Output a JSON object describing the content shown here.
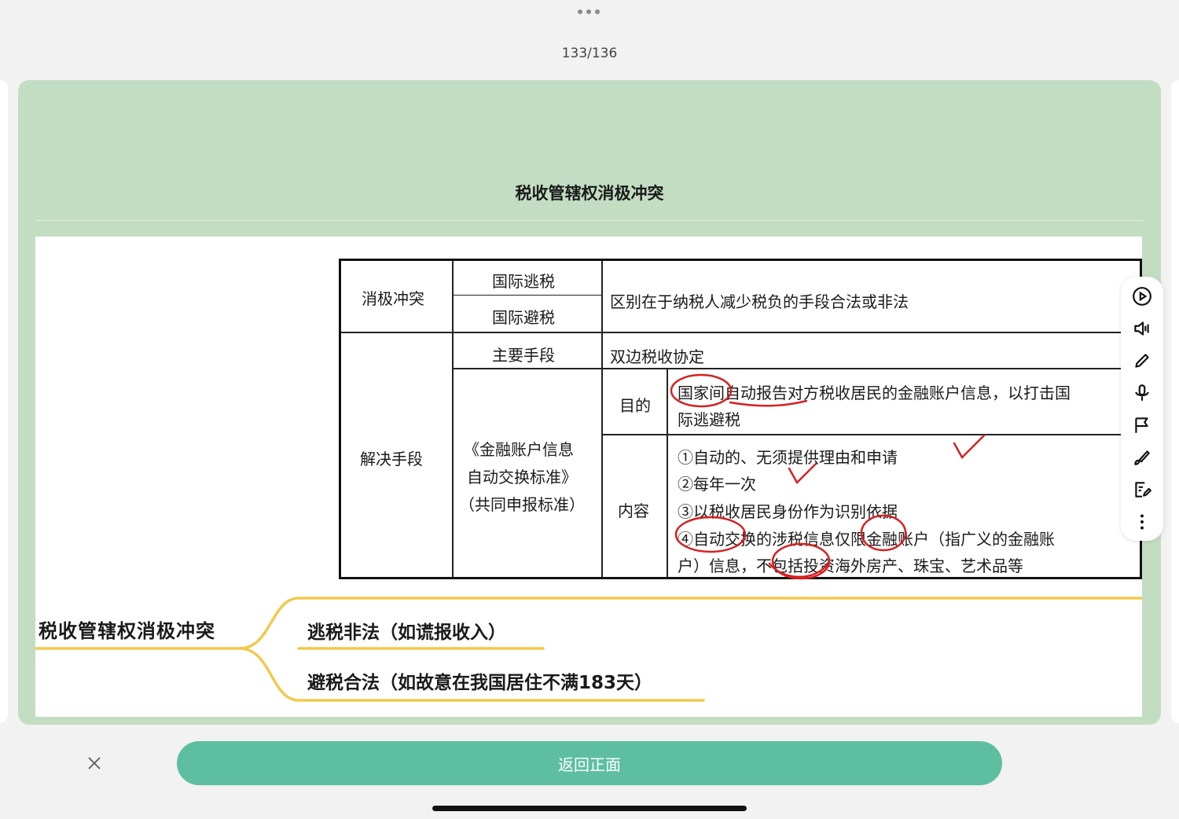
{
  "header": {
    "page_counter": "133/136"
  },
  "card": {
    "title": "税收管辖权消极冲突",
    "table": {
      "r1c1": "消极冲突",
      "r1c2a": "国际逃税",
      "r1c2b": "国际避税",
      "r1c3": "区别在于纳税人减少税负的手段合法或非法",
      "r2c1": "解决手段",
      "r2c2": "主要手段",
      "r2c3": "双边税收协定",
      "r3c2_line1": "《金融账户信息",
      "r3c2_line2": "自动交换标准》",
      "r3c2_line3": "（共同申报标准）",
      "purpose_label": "目的",
      "purpose_line1": "国家间自动报告对方税收居民的金融账户信息，以打击国",
      "purpose_line2": "际逃避税",
      "content_label": "内容",
      "content_1": "①自动的、无须提供理由和申请",
      "content_2": "②每年一次",
      "content_3": "③以税收居民身份作为识别依据",
      "content_4a": "④自动交换的涉税信息仅限金融账户（指广义的金融账",
      "content_4b": "户）信息，不包括投资海外房产、珠宝、艺术品等"
    },
    "mindmap": {
      "root": "税收管辖权消极冲突",
      "branch_1": "逃税非法（如谎报收入）",
      "branch_2": "避税合法（如故意在我国居住不满183天）"
    }
  },
  "tools": [
    "play-icon",
    "speaker-icon",
    "pencil-icon",
    "microphone-icon",
    "flag-icon",
    "brush-icon",
    "note-edit-icon",
    "more-vertical-icon"
  ],
  "bottom": {
    "back_button_label": "返回正面"
  },
  "colors": {
    "card_bg": "#c3ddc3",
    "accent_button": "#5dbfa0",
    "mindmap_line": "#f2c94c",
    "annotation_red": "#d62020"
  }
}
